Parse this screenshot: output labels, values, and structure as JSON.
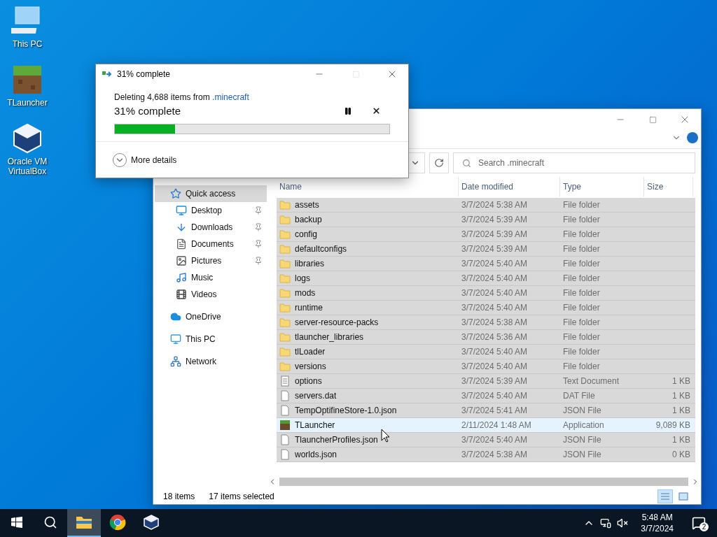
{
  "desktop_icons": [
    {
      "label": "This PC",
      "kind": "pc"
    },
    {
      "label": "TLauncher",
      "kind": "grass"
    },
    {
      "label": "Oracle VM VirtualBox",
      "kind": "cube"
    }
  ],
  "explorer": {
    "search": {
      "placeholder": "Search .minecraft"
    },
    "nav": [
      {
        "label": "Quick access",
        "kind": "star",
        "selected": true,
        "children": [
          {
            "label": "Desktop",
            "kind": "desktop",
            "pinned": true,
            "selected": false
          },
          {
            "label": "Downloads",
            "kind": "downloads",
            "pinned": true,
            "selected": false
          },
          {
            "label": "Documents",
            "kind": "documents",
            "pinned": true,
            "selected": false
          },
          {
            "label": "Pictures",
            "kind": "pictures",
            "pinned": true,
            "selected": false
          },
          {
            "label": "Music",
            "kind": "music",
            "pinned": false,
            "selected": false
          },
          {
            "label": "Videos",
            "kind": "videos",
            "pinned": false,
            "selected": false
          }
        ]
      },
      {
        "label": "OneDrive",
        "kind": "cloud",
        "selected": false
      },
      {
        "label": "This PC",
        "kind": "pc",
        "selected": false
      },
      {
        "label": "Network",
        "kind": "network",
        "selected": false
      }
    ],
    "columns": [
      "Name",
      "Date modified",
      "Type",
      "Size"
    ],
    "rows": [
      {
        "name": "assets",
        "date": "3/7/2024 5:38 AM",
        "type": "File folder",
        "kind": "folder",
        "selected": true
      },
      {
        "name": "backup",
        "date": "3/7/2024 5:39 AM",
        "type": "File folder",
        "kind": "folder",
        "selected": true
      },
      {
        "name": "config",
        "date": "3/7/2024 5:39 AM",
        "type": "File folder",
        "kind": "folder",
        "selected": true
      },
      {
        "name": "defaultconfigs",
        "date": "3/7/2024 5:39 AM",
        "type": "File folder",
        "kind": "folder",
        "selected": true
      },
      {
        "name": "libraries",
        "date": "3/7/2024 5:40 AM",
        "type": "File folder",
        "kind": "folder",
        "selected": true
      },
      {
        "name": "logs",
        "date": "3/7/2024 5:40 AM",
        "type": "File folder",
        "kind": "folder",
        "selected": true
      },
      {
        "name": "mods",
        "date": "3/7/2024 5:40 AM",
        "type": "File folder",
        "kind": "folder",
        "selected": true
      },
      {
        "name": "runtime",
        "date": "3/7/2024 5:40 AM",
        "type": "File folder",
        "kind": "folder",
        "selected": true
      },
      {
        "name": "server-resource-packs",
        "date": "3/7/2024 5:38 AM",
        "type": "File folder",
        "kind": "folder",
        "selected": true
      },
      {
        "name": "tlauncher_libraries",
        "date": "3/7/2024 5:36 AM",
        "type": "File folder",
        "kind": "folder",
        "selected": true
      },
      {
        "name": "tlLoader",
        "date": "3/7/2024 5:40 AM",
        "type": "File folder",
        "kind": "folder",
        "selected": true
      },
      {
        "name": "versions",
        "date": "3/7/2024 5:40 AM",
        "type": "File folder",
        "kind": "folder",
        "selected": true
      },
      {
        "name": "options",
        "date": "3/7/2024 5:39 AM",
        "type": "Text Document",
        "size": "1 KB",
        "kind": "text",
        "selected": true
      },
      {
        "name": "servers.dat",
        "date": "3/7/2024 5:40 AM",
        "type": "DAT File",
        "size": "1 KB",
        "kind": "file",
        "selected": true
      },
      {
        "name": "TempOptifineStore-1.0.json",
        "date": "3/7/2024 5:41 AM",
        "type": "JSON File",
        "size": "1 KB",
        "kind": "file",
        "selected": true
      },
      {
        "name": "TLauncher",
        "date": "2/11/2024 1:48 AM",
        "type": "Application",
        "size": "9,089 KB",
        "kind": "app",
        "selected": false
      },
      {
        "name": "TlauncherProfiles.json",
        "date": "3/7/2024 5:40 AM",
        "type": "JSON File",
        "size": "1 KB",
        "kind": "file",
        "selected": true
      },
      {
        "name": "worlds.json",
        "date": "3/7/2024 5:38 AM",
        "type": "JSON File",
        "size": "0 KB",
        "kind": "file",
        "selected": true
      }
    ],
    "status": {
      "count": "18 items",
      "selection": "17 items selected"
    }
  },
  "dialog": {
    "title": "31% complete",
    "message": "Deleting 4,688 items from ",
    "source": ".minecraft",
    "progress_text": "31% complete",
    "level": 0.22,
    "details": "More details"
  },
  "taskbar": {
    "apps": [
      {
        "kind": "explorer",
        "active": true
      },
      {
        "kind": "chrome",
        "active": false
      },
      {
        "kind": "virtualbox",
        "active": false
      }
    ],
    "time": "5:48 AM",
    "date": "3/7/2024",
    "notifications": "2"
  }
}
